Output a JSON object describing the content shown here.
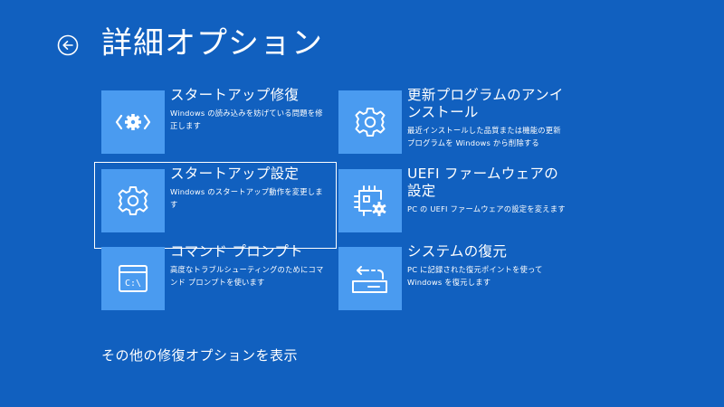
{
  "page": {
    "title": "詳細オプション",
    "back_icon": "back-arrow-circle-icon"
  },
  "options": [
    {
      "title": "スタートアップ修復",
      "description": "Windows の読み込みを妨げている問題を修正します",
      "icon": "startup-repair-icon"
    },
    {
      "title": "更新プログラムのアンインストール",
      "description": "最近インストールした品質または機能の更新プログラムを Windows から削除する",
      "icon": "gear-icon"
    },
    {
      "title": "スタートアップ設定",
      "description": "Windows のスタートアップ動作を変更します",
      "icon": "gear-icon",
      "selected": true
    },
    {
      "title": "UEFI ファームウェアの設定",
      "description": "PC の UEFI ファームウェアの設定を変えます",
      "icon": "firmware-chip-gear-icon"
    },
    {
      "title": "コマンド プロンプト",
      "description": "高度なトラブルシューティングのためにコマンド プロンプトを使います",
      "icon": "command-prompt-icon"
    },
    {
      "title": "システムの復元",
      "description": "PC に記録された復元ポイントを使って Windows を復元します",
      "icon": "system-restore-icon"
    }
  ],
  "footer": {
    "more_options_link": "その他の修復オプションを表示"
  },
  "colors": {
    "background": "#1160bf",
    "tile_icon_background": "#4a9bf0",
    "text": "#ffffff"
  }
}
